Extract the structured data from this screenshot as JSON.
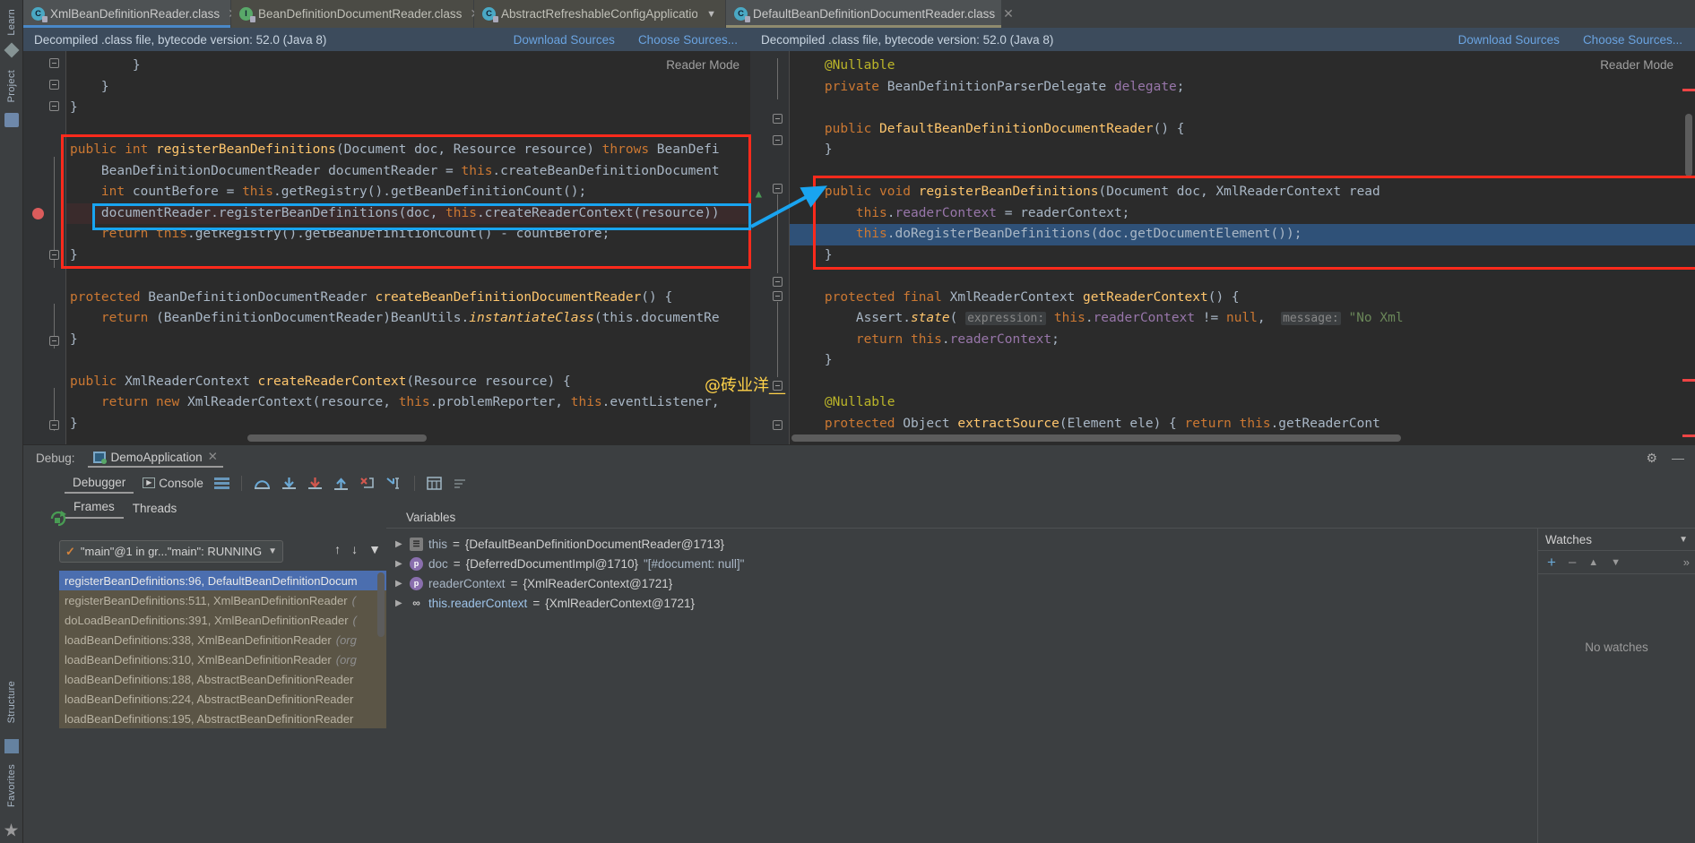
{
  "left_strip": {
    "items": [
      {
        "label": "Project",
        "name": "tool-project"
      },
      {
        "label": "Structure",
        "name": "tool-structure"
      },
      {
        "label": "Favorites",
        "name": "tool-favorites"
      }
    ],
    "learn_label": "Learn"
  },
  "tabs": [
    {
      "label": "XmlBeanDefinitionReader.class",
      "icon": "class-icon",
      "state": "active-blue",
      "closable": true
    },
    {
      "label": "BeanDefinitionDocumentReader.class",
      "icon": "interface-icon",
      "state": "inactive",
      "closable": true
    },
    {
      "label": "AbstractRefreshableConfigApplicationC",
      "icon": "class-icon",
      "state": "inactive",
      "closable": false,
      "dropdown": true
    },
    {
      "label": "DefaultBeanDefinitionDocumentReader.class",
      "icon": "class-icon",
      "state": "active-olive",
      "closable": true
    }
  ],
  "banner_left": {
    "text": "Decompiled .class file, bytecode version: 52.0 (Java 8)",
    "download_sources": "Download Sources",
    "choose_sources": "Choose Sources..."
  },
  "banner_right": {
    "text": "Decompiled .class file, bytecode version: 52.0 (Java 8)",
    "download_sources": "Download Sources",
    "choose_sources": "Choose Sources..."
  },
  "reader_mode_label": "Reader Mode",
  "watermark": "@砖业洋__",
  "editor_left": {
    "file": "XmlBeanDefinitionReader.class",
    "lines": [
      {
        "id": "l1",
        "text": "        }"
      },
      {
        "id": "l2",
        "text": "    }"
      },
      {
        "id": "l3",
        "text": "}"
      },
      {
        "id": "l4",
        "text": ""
      },
      {
        "id": "l5",
        "text": "public int registerBeanDefinitions(Document doc, Resource resource) throws BeanDefi"
      },
      {
        "id": "l6",
        "text": "    BeanDefinitionDocumentReader documentReader = this.createBeanDefinitionDocument"
      },
      {
        "id": "l7",
        "text": "    int countBefore = this.getRegistry().getBeanDefinitionCount();"
      },
      {
        "id": "l8",
        "text": "    documentReader.registerBeanDefinitions(doc, this.createReaderContext(resource))",
        "highlight": "breakpoint"
      },
      {
        "id": "l9",
        "text": "    return this.getRegistry().getBeanDefinitionCount() - countBefore;"
      },
      {
        "id": "l10",
        "text": "}"
      },
      {
        "id": "l11",
        "text": ""
      },
      {
        "id": "l12",
        "text": "protected BeanDefinitionDocumentReader createBeanDefinitionDocumentReader() {"
      },
      {
        "id": "l13",
        "text": "    return (BeanDefinitionDocumentReader)BeanUtils.instantiateClass(this.documentRe"
      },
      {
        "id": "l14",
        "text": "}"
      },
      {
        "id": "l15",
        "text": ""
      },
      {
        "id": "l16",
        "text": "public XmlReaderContext createReaderContext(Resource resource) {"
      },
      {
        "id": "l17",
        "text": "    return new XmlReaderContext(resource, this.problemReporter, this.eventListener,"
      },
      {
        "id": "l18",
        "text": "}"
      }
    ]
  },
  "editor_right": {
    "file": "DefaultBeanDefinitionDocumentReader.class",
    "lines": [
      {
        "id": "r1",
        "text": "@Nullable"
      },
      {
        "id": "r2",
        "text": "private BeanDefinitionParserDelegate delegate;"
      },
      {
        "id": "r3",
        "text": ""
      },
      {
        "id": "r4",
        "text": "public DefaultBeanDefinitionDocumentReader() {"
      },
      {
        "id": "r5",
        "text": "}"
      },
      {
        "id": "r6",
        "text": ""
      },
      {
        "id": "r7",
        "text": "public void registerBeanDefinitions(Document doc, XmlReaderContext read"
      },
      {
        "id": "r8",
        "text": "    this.readerContext = readerContext;"
      },
      {
        "id": "r9",
        "text": "    this.doRegisterBeanDefinitions(doc.getDocumentElement());",
        "highlight": "current"
      },
      {
        "id": "r10",
        "text": "}"
      },
      {
        "id": "r11",
        "text": ""
      },
      {
        "id": "r12",
        "text": "protected final XmlReaderContext getReaderContext() {"
      },
      {
        "id": "r13",
        "text": "    Assert.state( expression: this.readerContext != null,  message: \"No Xml",
        "hint1": "expression:",
        "hint2": "message:"
      },
      {
        "id": "r14",
        "text": "    return this.readerContext;"
      },
      {
        "id": "r15",
        "text": "}"
      },
      {
        "id": "r16",
        "text": ""
      },
      {
        "id": "r17",
        "text": "@Nullable"
      },
      {
        "id": "r18",
        "text": "protected Object extractSource(Element ele) { return this.getReaderCont"
      }
    ]
  },
  "debug": {
    "label": "Debug:",
    "config_name": "DemoApplication",
    "tabs": [
      {
        "label": "Debugger",
        "selected": true
      },
      {
        "label": "Console",
        "selected": false
      }
    ],
    "subtabs": [
      {
        "label": "Frames",
        "selected": true
      },
      {
        "label": "Threads",
        "selected": false
      }
    ],
    "thread_selector": "\"main\"@1 in gr...\"main\": RUNNING",
    "frames": [
      {
        "text": "registerBeanDefinitions:96, DefaultBeanDefinitionDocum",
        "pkg": "",
        "state": "selected"
      },
      {
        "text": "registerBeanDefinitions:511, XmlBeanDefinitionReader",
        "pkg": "(",
        "state": "normal"
      },
      {
        "text": "doLoadBeanDefinitions:391, XmlBeanDefinitionReader",
        "pkg": "(",
        "state": "normal"
      },
      {
        "text": "loadBeanDefinitions:338, XmlBeanDefinitionReader",
        "pkg": "(org",
        "state": "normal"
      },
      {
        "text": "loadBeanDefinitions:310, XmlBeanDefinitionReader",
        "pkg": "(org",
        "state": "normal"
      },
      {
        "text": "loadBeanDefinitions:188, AbstractBeanDefinitionReader",
        "pkg": "",
        "state": "normal"
      },
      {
        "text": "loadBeanDefinitions:224, AbstractBeanDefinitionReader",
        "pkg": "",
        "state": "normal"
      },
      {
        "text": "loadBeanDefinitions:195, AbstractBeanDefinitionReader",
        "pkg": "",
        "state": "normal"
      }
    ],
    "variables_header": "Variables",
    "variables": [
      {
        "icon": "this-icon",
        "name": "this",
        "eq": "=",
        "value": "{DefaultBeanDefinitionDocumentReader@1713}",
        "extra": ""
      },
      {
        "icon": "param-icon",
        "name": "doc",
        "eq": "=",
        "value": "{DeferredDocumentImpl@1710}",
        "extra": "\"[#document: null]\""
      },
      {
        "icon": "param-icon",
        "name": "readerContext",
        "eq": "=",
        "value": "{XmlReaderContext@1721}",
        "extra": ""
      },
      {
        "icon": "field-icon",
        "name": "this.readerContext",
        "eq": "=",
        "value": "{XmlReaderContext@1721}",
        "extra": ""
      }
    ],
    "watches_header": "Watches",
    "watches_empty": "No watches"
  },
  "colors": {
    "accent_blue": "#4a88c7",
    "annotation_red": "#ff2a1c",
    "annotation_blue": "#19a4f0",
    "watermark_yellow": "#ffd24a",
    "selection_blue": "#4b6eaf",
    "editor_bg": "#2b2b2b",
    "panel_bg": "#3c3f41"
  }
}
